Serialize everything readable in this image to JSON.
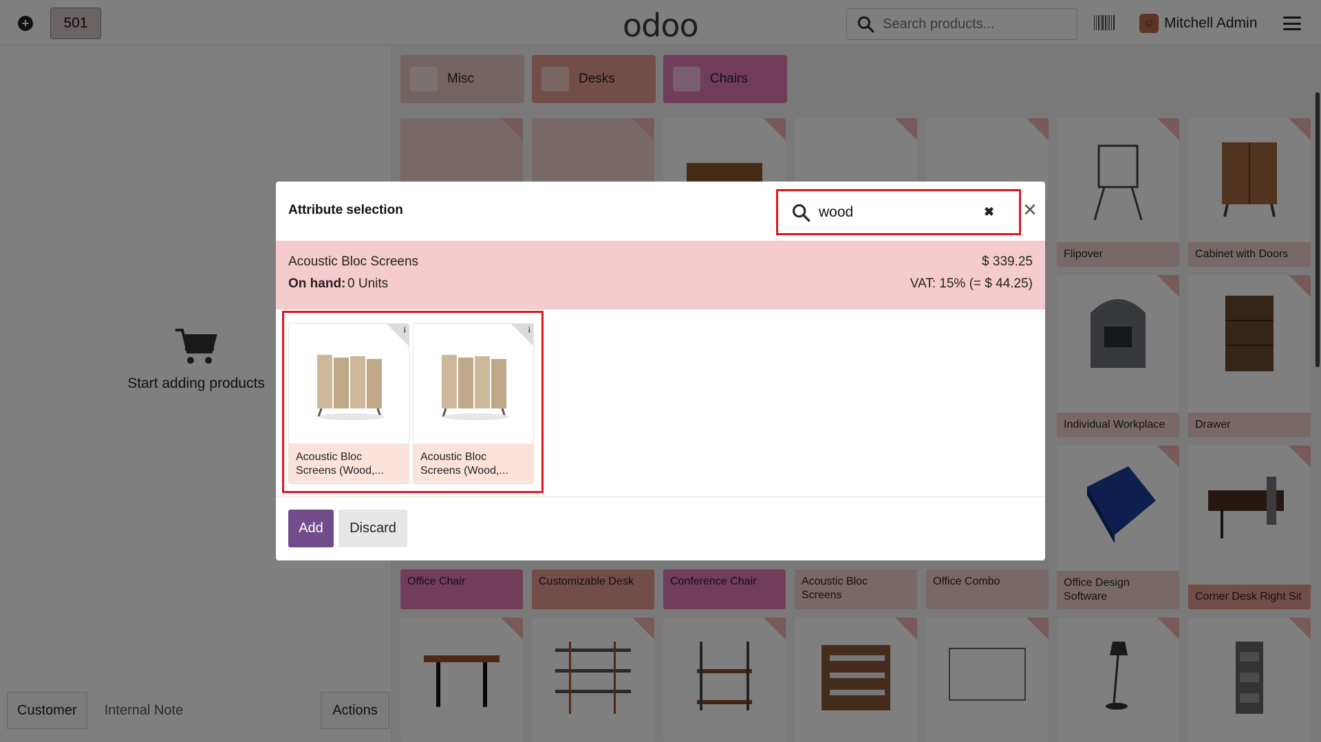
{
  "topbar": {
    "order_number": "501",
    "logo": "odoo",
    "search_placeholder": "Search products...",
    "user_name": "Mitchell Admin"
  },
  "leftpane": {
    "empty_message": "Start adding products",
    "customer_label": "Customer",
    "note_label": "Internal Note",
    "actions_label": "Actions"
  },
  "categories": [
    "Misc",
    "Desks",
    "Chairs"
  ],
  "products": {
    "flipover": "Flipover",
    "cabinet": "Cabinet with Doors",
    "individual": "Individual Workplace",
    "drawer": "Drawer",
    "office_chair": "Office Chair",
    "custom_desk": "Customizable Desk",
    "conf_chair": "Conference Chair",
    "acoustic": "Acoustic Bloc Screens",
    "office_combo": "Office Combo",
    "office_software": "Office Design Software",
    "corner_desk": "Corner Desk Right Sit"
  },
  "modal": {
    "title": "Attribute selection",
    "search_value": "wood",
    "product_name": "Acoustic Bloc Screens",
    "on_hand_label": "On hand:",
    "on_hand_value": "0 Units",
    "price": "$ 339.25",
    "vat": "VAT: 15% (= $ 44.25)",
    "variants": [
      {
        "name": "Acoustic Bloc Screens (Wood,..."
      },
      {
        "name": "Acoustic Bloc Screens (Wood,..."
      }
    ],
    "add_label": "Add",
    "discard_label": "Discard"
  },
  "colors": {
    "accent": "#714b8a",
    "highlight": "#e3141f",
    "product_band": "#f6cbcd"
  }
}
